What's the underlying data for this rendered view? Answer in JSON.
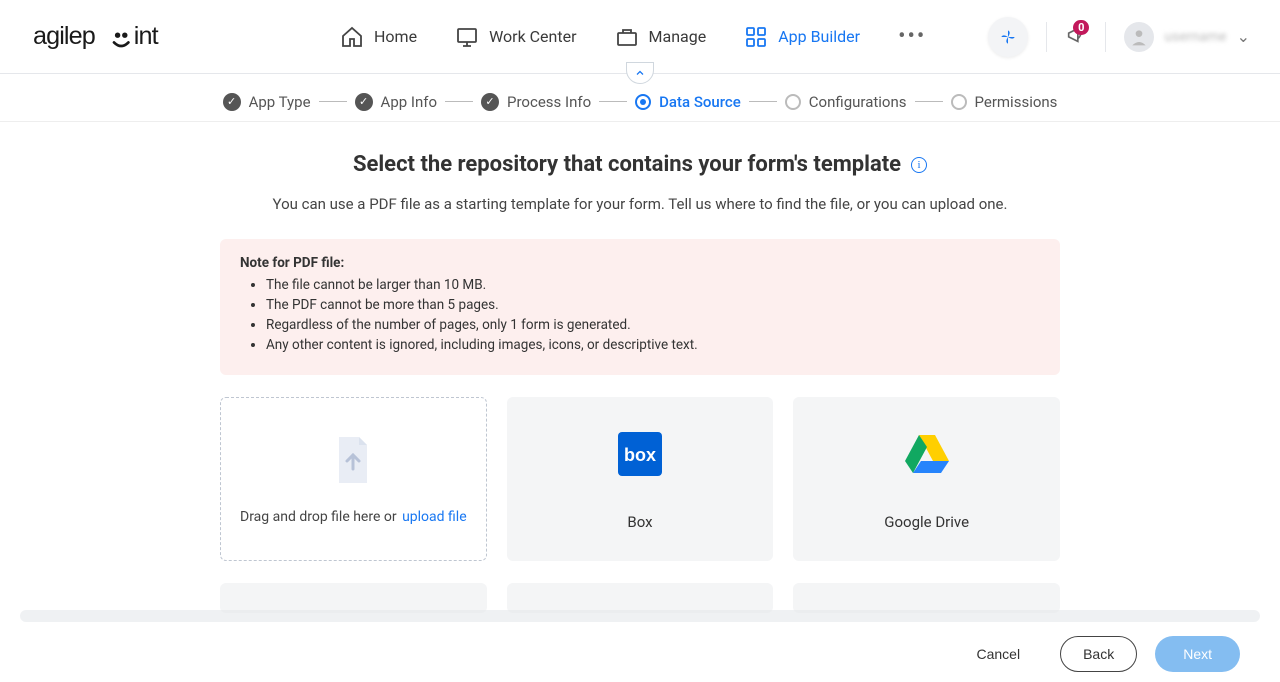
{
  "nav": {
    "items": [
      {
        "label": "Home"
      },
      {
        "label": "Work Center"
      },
      {
        "label": "Manage"
      },
      {
        "label": "App Builder"
      }
    ]
  },
  "badge_count": "0",
  "user_name": "username",
  "wizard": {
    "steps": [
      {
        "label": "App Type"
      },
      {
        "label": "App Info"
      },
      {
        "label": "Process Info"
      },
      {
        "label": "Data Source"
      },
      {
        "label": "Configurations"
      },
      {
        "label": "Permissions"
      }
    ]
  },
  "page": {
    "title": "Select the repository that contains your form's template",
    "subtitle": "You can use a PDF file as a starting template for your form. Tell us where to find the file, or you can upload one.",
    "note_title": "Note for PDF file:",
    "notes": [
      "The file cannot be larger than 10 MB.",
      "The PDF cannot be more than 5 pages.",
      "Regardless of the number of pages, only 1 form is generated.",
      "Any other content is ignored, including images, icons, or descriptive text."
    ],
    "upload_text": "Drag and drop file here or ",
    "upload_link": "upload file",
    "cards": [
      {
        "label": "Box"
      },
      {
        "label": "Google Drive"
      }
    ]
  },
  "footer": {
    "cancel": "Cancel",
    "back": "Back",
    "next": "Next"
  }
}
